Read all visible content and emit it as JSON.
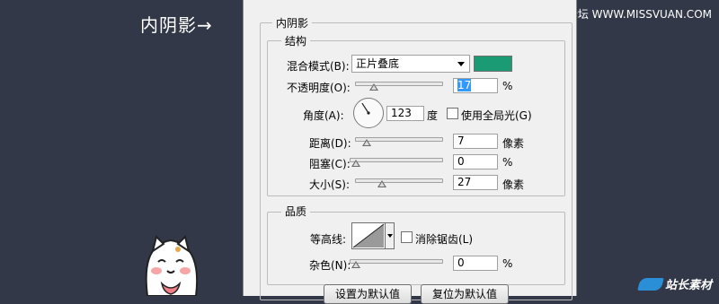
{
  "caption": "内阴影→",
  "watermark_top": "思缘设计论坛 WWW.MISSVUAN.COM",
  "watermark_bottom": "站长素材",
  "dialog": {
    "title": "内阴影",
    "structure": {
      "title": "结构",
      "blend_mode_label": "混合模式(B):",
      "blend_mode_value": "正片叠底",
      "color": "#1a9b74",
      "opacity_label": "不透明度(O):",
      "opacity_value": "17",
      "opacity_unit": "%",
      "angle_label": "角度(A):",
      "angle_value": "123",
      "angle_unit": "度",
      "global_light_label": "使用全局光(G)",
      "global_light_checked": false,
      "distance_label": "距离(D):",
      "distance_value": "7",
      "distance_unit": "像素",
      "choke_label": "阻塞(C):",
      "choke_value": "0",
      "choke_unit": "%",
      "size_label": "大小(S):",
      "size_value": "27",
      "size_unit": "像素"
    },
    "quality": {
      "title": "品质",
      "contour_label": "等高线:",
      "antialias_label": "消除锯齿(L)",
      "antialias_checked": false,
      "noise_label": "杂色(N):",
      "noise_value": "0",
      "noise_unit": "%"
    },
    "buttons": {
      "make_default": "设置为默认值",
      "reset_default": "复位为默认值"
    }
  }
}
